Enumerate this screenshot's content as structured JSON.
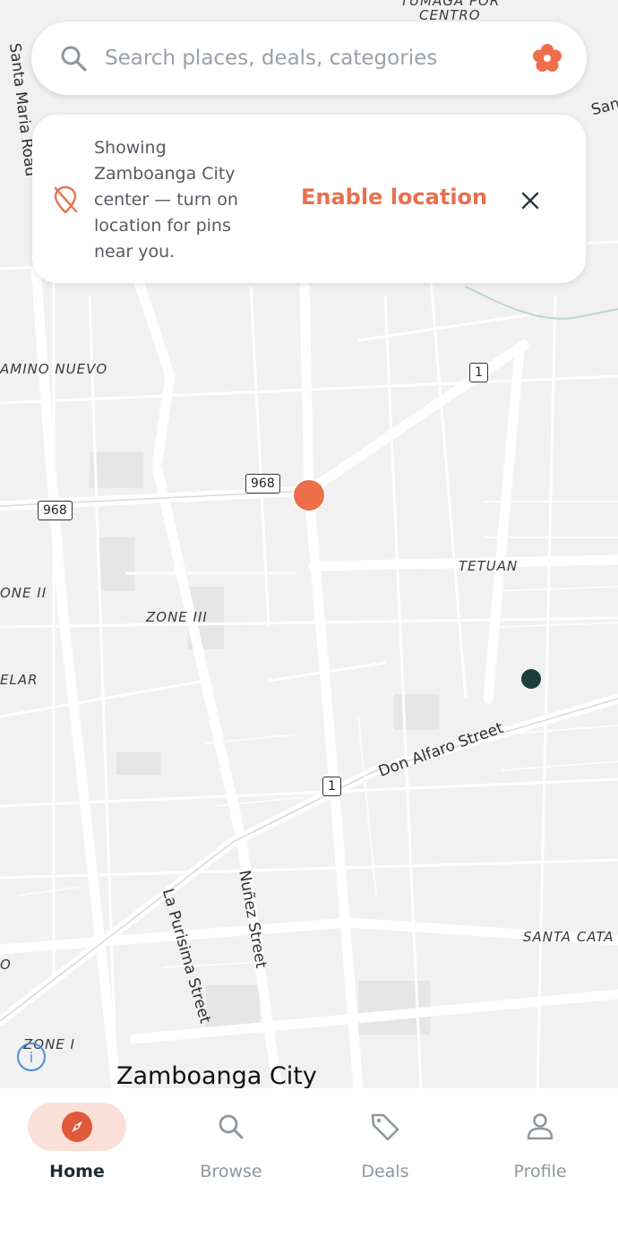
{
  "search": {
    "placeholder": "Search places, deals, categories"
  },
  "banner": {
    "message": "Showing Zamboanga City center — turn on location for pins near you.",
    "action_label": "Enable location"
  },
  "map": {
    "labels": {
      "tumaga": "TUMAGA POR",
      "centro": "CENTRO",
      "camino_nuevo": "AMINO NUEVO",
      "tetuan": "TETUAN",
      "zone_ii": "ONE II",
      "zone_iii": "ZONE III",
      "elar": "ELAR",
      "santa_cata": "SANTA CATA",
      "zone_i": "ZONE I",
      "left_o": "O"
    },
    "streets": {
      "santa_maria": "Santa Maria Road",
      "san": "San",
      "don_alfaro": "Don Alfaro Street",
      "nunez": "Nuñez Street",
      "la_purisima": "La Purisima Street"
    },
    "shields": {
      "r968a": "968",
      "r968b": "968",
      "r1a": "1",
      "r1b": "1"
    },
    "city": "Zamboanga City"
  },
  "nav": {
    "items": [
      {
        "label": "Home",
        "icon": "compass-icon"
      },
      {
        "label": "Browse",
        "icon": "search-icon"
      },
      {
        "label": "Deals",
        "icon": "tag-icon"
      },
      {
        "label": "Profile",
        "icon": "person-icon"
      }
    ]
  },
  "colors": {
    "accent": "#e8704e",
    "pin": "#ee6e4a",
    "pin_dark": "#1d3c3c",
    "active_pill": "#fbe0d7"
  }
}
